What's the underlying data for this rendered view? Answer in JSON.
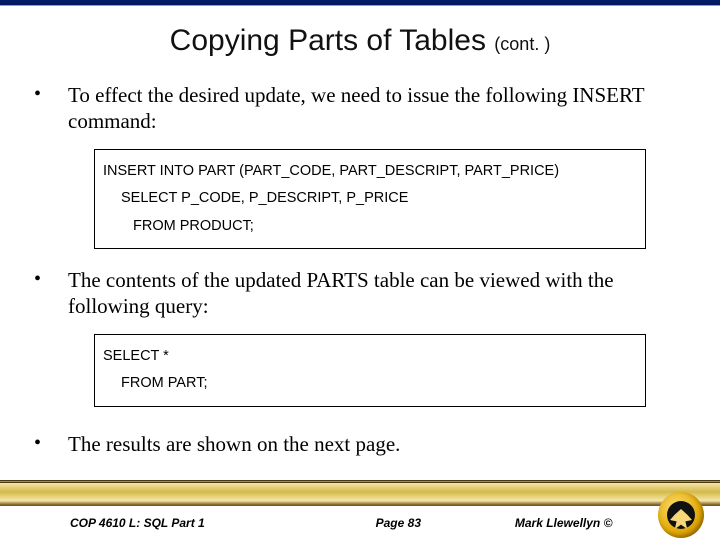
{
  "title_main": "Copying Parts of Tables ",
  "title_cont": "(cont. )",
  "bullets": {
    "b1": "To effect the desired update, we need to issue the following INSERT command:",
    "b2": "The contents of the updated PARTS table can be viewed with the following query:",
    "b3": "The results are shown on the next page."
  },
  "code1": {
    "l1": "INSERT INTO PART (PART_CODE, PART_DESCRIPT, PART_PRICE)",
    "l2": "SELECT P_CODE, P_DESCRIPT, P_PRICE",
    "l3": "FROM PRODUCT;"
  },
  "code2": {
    "l1": "SELECT *",
    "l2": "FROM PART;"
  },
  "footer": {
    "left": "COP 4610 L: SQL Part 1",
    "mid": "Page 83",
    "right": "Mark Llewellyn ©"
  }
}
